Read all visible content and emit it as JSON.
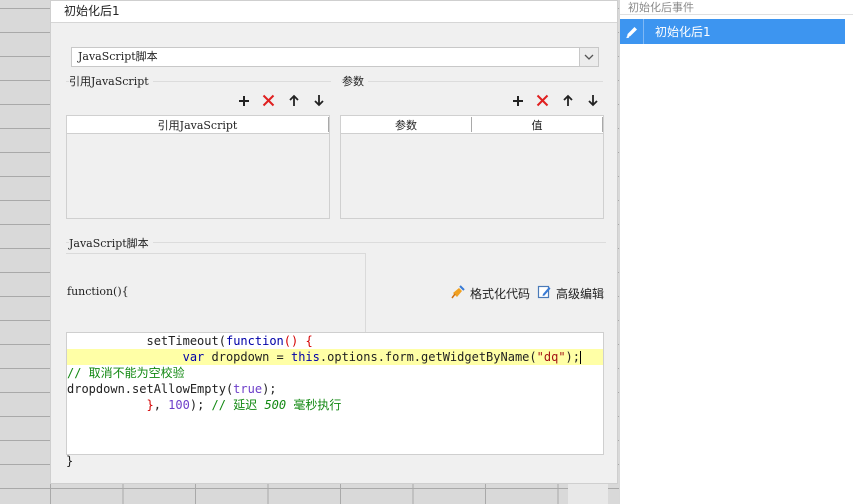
{
  "dialog": {
    "title": "初始化后1",
    "script_type": "JavaScript脚本",
    "ref_section": {
      "label": "引用JavaScript",
      "column": "引用JavaScript"
    },
    "params_section": {
      "label": "参数",
      "columns": [
        "参数",
        "值"
      ]
    },
    "script_section": {
      "label": "JavaScript脚本",
      "function_header": "function(){",
      "format_label": "格式化代码",
      "advanced_label": "高级编辑",
      "closing_brace": "}"
    },
    "code_lines": [
      "setTimeout(function() {",
      "var dropdown = this.options.form.getWidgetByName(\"dq\");",
      "// 取消不能为空校验",
      "dropdown.setAllowEmpty(true);",
      "}, 100); // 延迟 500 毫秒执行"
    ]
  },
  "events_panel": {
    "header": "初始化后事件",
    "items": [
      {
        "label": "初始化后1",
        "icon": "edit-icon",
        "selected": true
      }
    ]
  },
  "colors": {
    "selection": "#3d95f0",
    "delete": "#e02020",
    "highlight_line": "#ffffa6"
  }
}
